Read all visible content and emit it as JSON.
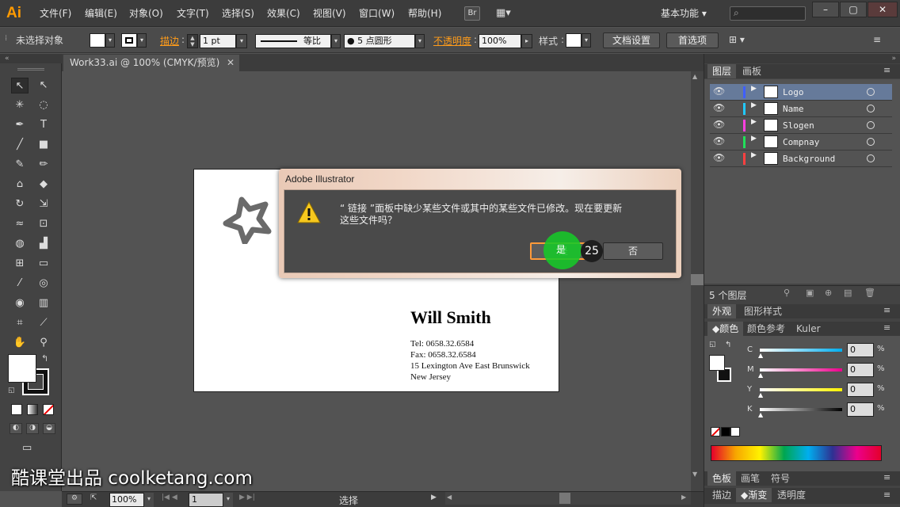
{
  "app": {
    "logo": "Ai"
  },
  "menu": [
    "文件(F)",
    "编辑(E)",
    "对象(O)",
    "文字(T)",
    "选择(S)",
    "效果(C)",
    "视图(V)",
    "窗口(W)",
    "帮助(H)"
  ],
  "menubar": {
    "br_label": "Br",
    "workspace": "基本功能",
    "search_placeholder": ""
  },
  "control": {
    "selection_label": "未选择对象",
    "stroke_label": "描边",
    "stroke_value": "1 pt",
    "profile_label": "等比",
    "brush_label": "5 点圆形",
    "opacity_label": "不透明度",
    "opacity_value": "100%",
    "style_label": "样式",
    "doc_settings": "文档设置",
    "preferences": "首选项"
  },
  "doc_tab": {
    "title": "Work33.ai @ 100% (CMYK/预览)"
  },
  "artboard": {
    "name": "Will Smith",
    "tel": "Tel: 0658.32.6584",
    "fax": "Fax: 0658.32.6584",
    "addr1": "15 Lexington Ave East Brunswick",
    "addr2": "New Jersey"
  },
  "dialog": {
    "title": "Adobe Illustrator",
    "message_line1": "“ 链接 ”面板中缺少某些文件或其中的某些文件已修改。现在要更新",
    "message_line2": "这些文件吗？",
    "yes": "是",
    "no": "否",
    "step_badge": "25"
  },
  "layers_panel": {
    "tab_layers": "图层",
    "tab_artboards": "画板",
    "layers": [
      {
        "name": "Logo",
        "color": "#3f5fff"
      },
      {
        "name": "Name",
        "color": "#22c9ff"
      },
      {
        "name": "Slogen",
        "color": "#ff3fe0"
      },
      {
        "name": "Compnay",
        "color": "#22e05a"
      },
      {
        "name": "Background",
        "color": "#ff4040"
      }
    ],
    "count": "5 个图层"
  },
  "appearance": {
    "tab_appearance": "外观",
    "tab_graphic_styles": "图形样式"
  },
  "color_panel": {
    "tab_color": "颜色",
    "tab_guide": "颜色参考",
    "tab_kuler": "Kuler",
    "channels": [
      {
        "label": "C",
        "value": "0",
        "unit": "%"
      },
      {
        "label": "M",
        "value": "0",
        "unit": "%"
      },
      {
        "label": "Y",
        "value": "0",
        "unit": "%"
      },
      {
        "label": "K",
        "value": "0",
        "unit": "%"
      }
    ]
  },
  "bottom_tabs": {
    "swatches": "色板",
    "brushes": "画笔",
    "symbols": "符号",
    "stroke": "描边",
    "gradient": "渐变",
    "transparency": "透明度"
  },
  "status": {
    "zoom": "100%",
    "page": "1",
    "tool": "选择"
  },
  "watermark": "酷课堂出品 coolketang.com"
}
